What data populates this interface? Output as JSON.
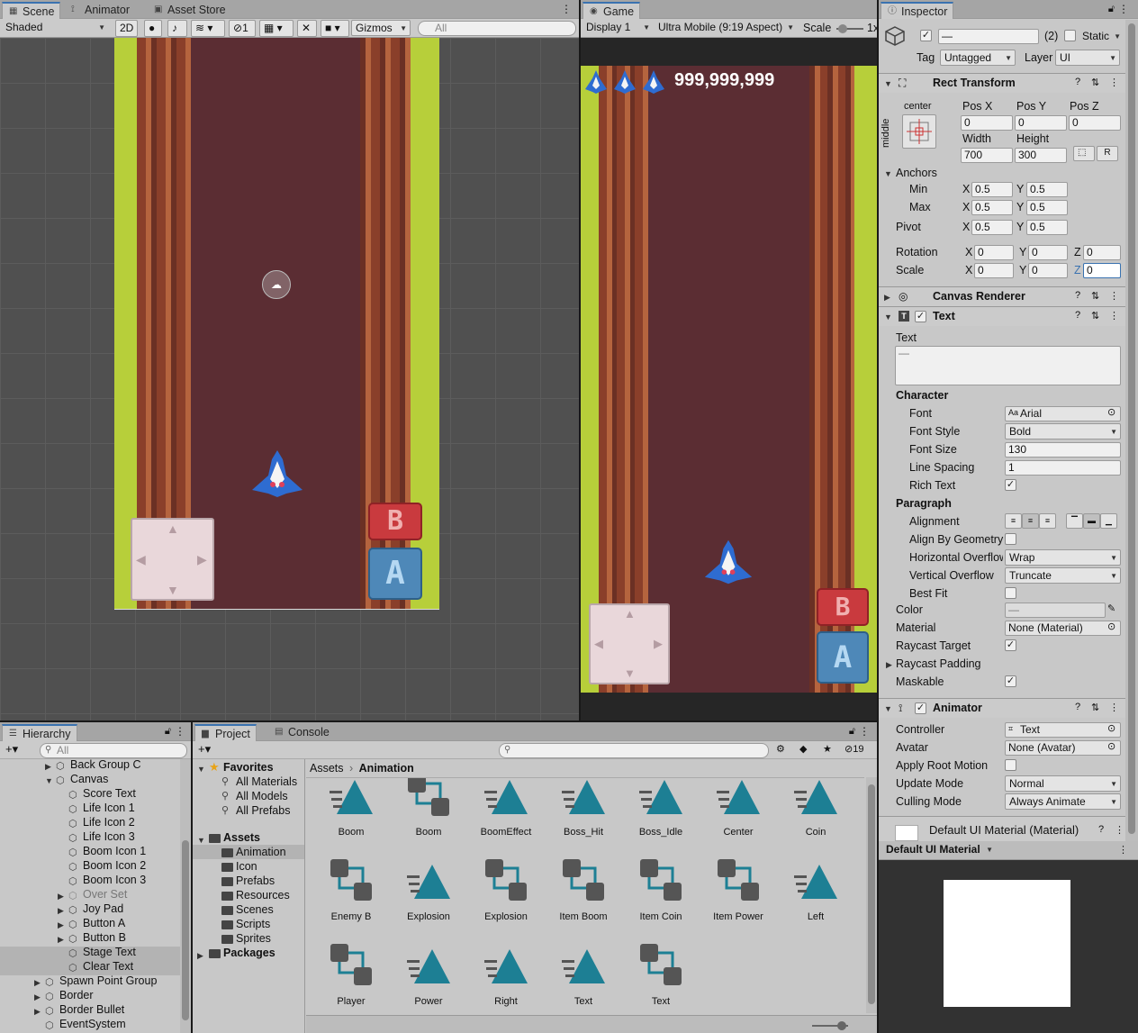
{
  "scene": {
    "tabs": [
      "Scene",
      "Animator",
      "Asset Store"
    ],
    "shading": "Shaded",
    "mode2d": "2D",
    "hidden_count": "1",
    "gizmos": "Gizmos",
    "search_placeholder": "All",
    "btn_b": "B",
    "btn_a": "A"
  },
  "game": {
    "tab": "Game",
    "display": "Display 1",
    "aspect": "Ultra Mobile (9:19 Aspect)",
    "scale_label": "Scale",
    "scale_value": "1x",
    "score": "999,999,999"
  },
  "inspector": {
    "tab": "Inspector",
    "object_name": "—",
    "count": "(2)",
    "static_label": "Static",
    "tag_label": "Tag",
    "tag_value": "Untagged",
    "layer_label": "Layer",
    "layer_value": "UI",
    "rect": {
      "title": "Rect Transform",
      "anchor_h": "center",
      "anchor_v": "middle",
      "posx_l": "Pos X",
      "posy_l": "Pos Y",
      "posz_l": "Pos Z",
      "posx": "0",
      "posy": "0",
      "posz": "0",
      "width_l": "Width",
      "height_l": "Height",
      "width": "700",
      "height": "300",
      "r": "R",
      "anchors": "Anchors",
      "min": "Min",
      "max": "Max",
      "pivot": "Pivot",
      "rotation": "Rotation",
      "scale": "Scale",
      "x": "X",
      "y": "Y",
      "z": "Z",
      "v05": "0.5",
      "v0": "0"
    },
    "canvas_renderer": "Canvas Renderer",
    "text": {
      "title": "Text",
      "text_label": "Text",
      "text_value": "—",
      "character": "Character",
      "font_l": "Font",
      "font": "Arial",
      "style_l": "Font Style",
      "style": "Bold",
      "size_l": "Font Size",
      "size": "130",
      "spacing_l": "Line Spacing",
      "spacing": "1",
      "rich_l": "Rich Text",
      "paragraph": "Paragraph",
      "align_l": "Alignment",
      "geom_l": "Align By Geometry",
      "hover_l": "Horizontal Overflow",
      "hover": "Wrap",
      "vover_l": "Vertical Overflow",
      "vover": "Truncate",
      "bestfit_l": "Best Fit",
      "color_l": "Color",
      "color_v": "—",
      "material_l": "Material",
      "material": "None (Material)",
      "raycast_l": "Raycast Target",
      "padding_l": "Raycast Padding",
      "maskable_l": "Maskable"
    },
    "animator": {
      "title": "Animator",
      "controller_l": "Controller",
      "controller": "Text",
      "avatar_l": "Avatar",
      "avatar": "None (Avatar)",
      "root_l": "Apply Root Motion",
      "update_l": "Update Mode",
      "update": "Normal",
      "culling_l": "Culling Mode",
      "culling": "Always Animate"
    },
    "material": {
      "title": "Default UI Material (Material)",
      "preview_dd": "Default UI Material"
    }
  },
  "hierarchy": {
    "tab": "Hierarchy",
    "search_placeholder": "All",
    "items": [
      "Back Group C",
      "Canvas",
      "Score Text",
      "Life Icon 1",
      "Life Icon 2",
      "Life Icon 3",
      "Boom Icon 1",
      "Boom Icon 2",
      "Boom Icon 3",
      "Over Set",
      "Joy Pad",
      "Button A",
      "Button B",
      "Stage Text",
      "Clear Text",
      "Spawn Point Group",
      "Border",
      "Border Bullet",
      "EventSystem"
    ]
  },
  "project": {
    "tab": "Project",
    "console_tab": "Console",
    "hidden_count": "19",
    "favorites": "Favorites",
    "fav_items": [
      "All Materials",
      "All Models",
      "All Prefabs"
    ],
    "assets": "Assets",
    "asset_folders": [
      "Animation",
      "Icon",
      "Prefabs",
      "Resources",
      "Scenes",
      "Scripts",
      "Sprites"
    ],
    "packages": "Packages",
    "breadcrumb_root": "Assets",
    "breadcrumb_current": "Animation",
    "grid": [
      {
        "name": "Boom",
        "kind": "anim"
      },
      {
        "name": "Boom",
        "kind": "ctrl"
      },
      {
        "name": "BoomEffect",
        "kind": "anim"
      },
      {
        "name": "Boss_Hit",
        "kind": "anim"
      },
      {
        "name": "Boss_Idle",
        "kind": "anim"
      },
      {
        "name": "Center",
        "kind": "anim"
      },
      {
        "name": "Coin",
        "kind": "anim"
      },
      {
        "name": "Enemy B",
        "kind": "ctrl"
      },
      {
        "name": "Explosion",
        "kind": "anim"
      },
      {
        "name": "Explosion",
        "kind": "ctrl"
      },
      {
        "name": "Item Boom",
        "kind": "ctrl"
      },
      {
        "name": "Item Coin",
        "kind": "ctrl"
      },
      {
        "name": "Item Power",
        "kind": "ctrl"
      },
      {
        "name": "Left",
        "kind": "anim"
      },
      {
        "name": "Player",
        "kind": "ctrl"
      },
      {
        "name": "Power",
        "kind": "anim"
      },
      {
        "name": "Right",
        "kind": "anim"
      },
      {
        "name": "Text",
        "kind": "anim"
      },
      {
        "name": "Text",
        "kind": "ctrl"
      }
    ]
  },
  "colors": {
    "accent": "#3a72b0",
    "asset_teal": "#1d7f94",
    "road": "#5b2d33",
    "grass": "#b7cf3a"
  }
}
